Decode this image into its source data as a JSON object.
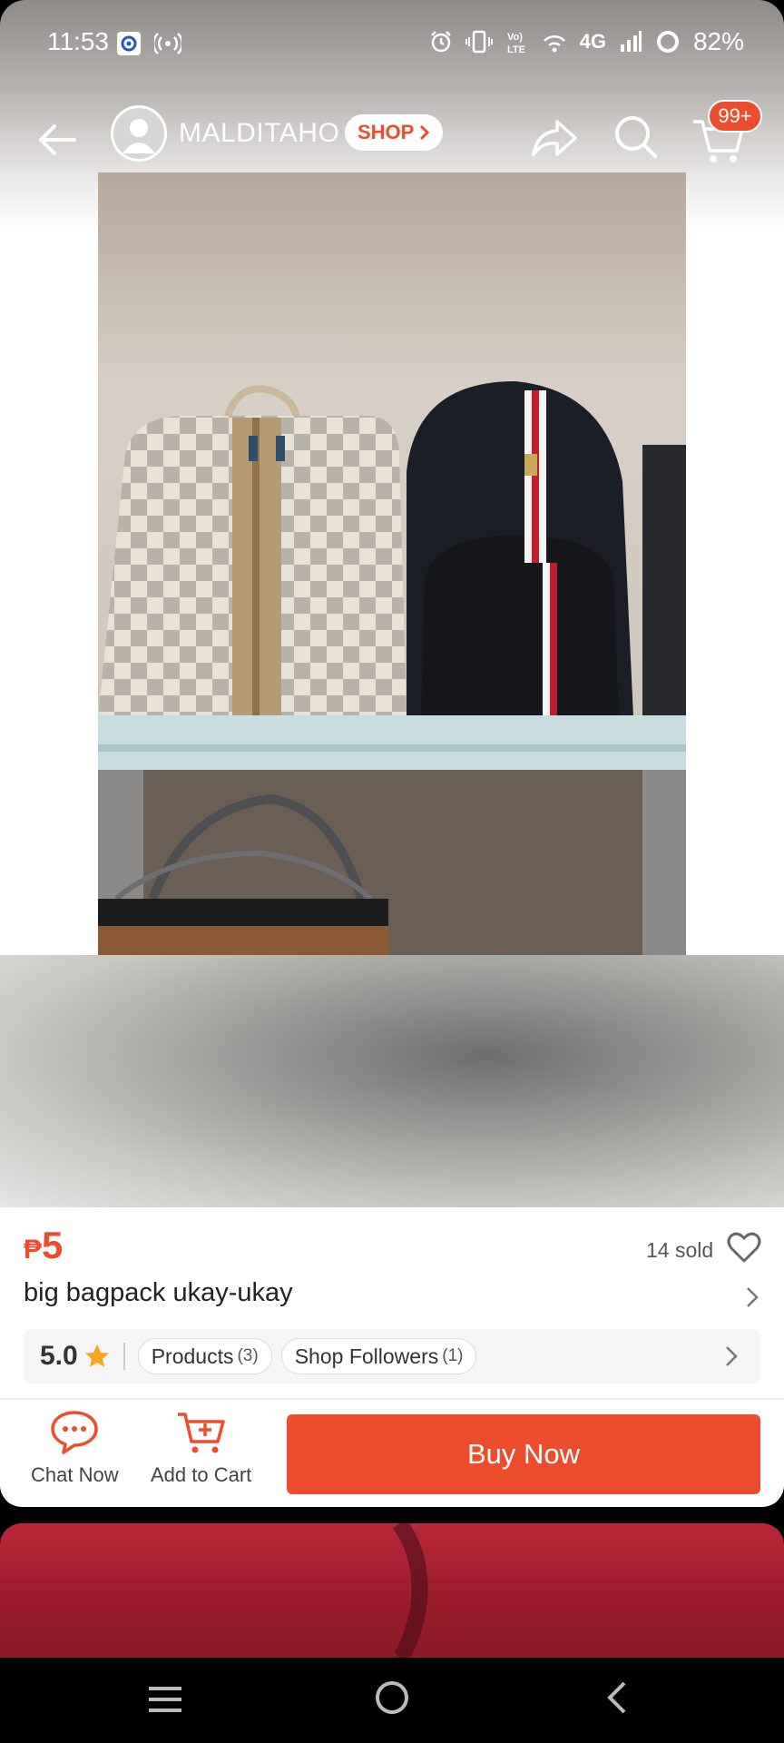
{
  "status_bar": {
    "time": "11:53",
    "battery": "82%",
    "network": "4G"
  },
  "header": {
    "shop_name": "MALDITAHO",
    "shop_badge": "SHOP",
    "cart_badge": "99+"
  },
  "product": {
    "currency": "₱",
    "price": "5",
    "sold": "14 sold",
    "title": "big bagpack ukay-ukay"
  },
  "shop_info": {
    "rating": "5.0",
    "products_label": "Products",
    "products_count": "(3)",
    "followers_label": "Shop Followers",
    "followers_count": "(1)"
  },
  "actions": {
    "chat": "Chat Now",
    "add_to_cart": "Add to Cart",
    "buy_now": "Buy Now"
  },
  "colors": {
    "accent": "#ee4d2d",
    "star": "#f6a623"
  }
}
